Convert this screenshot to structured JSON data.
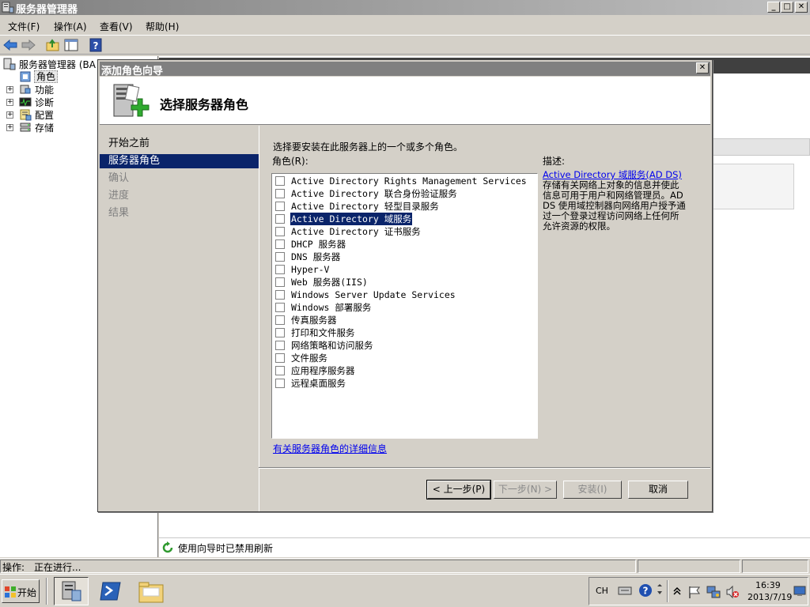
{
  "main_window": {
    "title": "服务器管理器",
    "controls": {
      "minimize": "_",
      "maximize": "□",
      "close": "✕"
    }
  },
  "menu": {
    "items": [
      "文件(F)",
      "操作(A)",
      "查看(V)",
      "帮助(H)"
    ]
  },
  "tree": {
    "root": "服务器管理器 (BA",
    "items": [
      "角色",
      "功能",
      "诊断",
      "配置",
      "存储"
    ],
    "expanders": [
      "+",
      "+",
      "+",
      "+"
    ]
  },
  "refresh_bar": {
    "text": "使用向导时已禁用刷新"
  },
  "status_bar": {
    "label": "操作:",
    "value": "正在进行..."
  },
  "taskbar": {
    "start_label": "开始",
    "tray": {
      "lang": "CH",
      "time": "16:39",
      "date": "2013/7/19"
    }
  },
  "dialog": {
    "title": "添加角色向导",
    "close": "✕",
    "header_title": "选择服务器角色",
    "nav": [
      {
        "label": "开始之前",
        "state": "normal"
      },
      {
        "label": "服务器角色",
        "state": "active"
      },
      {
        "label": "确认",
        "state": "disabled"
      },
      {
        "label": "进度",
        "state": "disabled"
      },
      {
        "label": "结果",
        "state": "disabled"
      }
    ],
    "instruction": "选择要安装在此服务器上的一个或多个角色。",
    "roles_label": "角色(R):",
    "roles": [
      {
        "label": "Active Directory Rights Management Services",
        "checked": false,
        "selected": false
      },
      {
        "label": "Active Directory 联合身份验证服务",
        "checked": false,
        "selected": false
      },
      {
        "label": "Active Directory 轻型目录服务",
        "checked": false,
        "selected": false
      },
      {
        "label": "Active Directory 域服务",
        "checked": false,
        "selected": true
      },
      {
        "label": "Active Directory 证书服务",
        "checked": false,
        "selected": false
      },
      {
        "label": "DHCP 服务器",
        "checked": false,
        "selected": false
      },
      {
        "label": "DNS 服务器",
        "checked": false,
        "selected": false
      },
      {
        "label": "Hyper-V",
        "checked": false,
        "selected": false
      },
      {
        "label": "Web 服务器(IIS)",
        "checked": false,
        "selected": false
      },
      {
        "label": "Windows Server Update Services",
        "checked": false,
        "selected": false
      },
      {
        "label": "Windows 部署服务",
        "checked": false,
        "selected": false
      },
      {
        "label": "传真服务器",
        "checked": false,
        "selected": false
      },
      {
        "label": "打印和文件服务",
        "checked": false,
        "selected": false
      },
      {
        "label": "网络策略和访问服务",
        "checked": false,
        "selected": false
      },
      {
        "label": "文件服务",
        "checked": false,
        "selected": false
      },
      {
        "label": "应用程序服务器",
        "checked": false,
        "selected": false
      },
      {
        "label": "远程桌面服务",
        "checked": false,
        "selected": false
      }
    ],
    "description_label": "描述:",
    "description_link": "Active Directory 域服务(AD DS)",
    "description_lines": [
      "存储有关网络上对象的信息并使此",
      "信息可用于用户和网络管理员。AD",
      "DS 使用域控制器向网络用户授予通",
      "过一个登录过程访问网络上任何所",
      "允许资源的权限。"
    ],
    "more_info_link": "有关服务器角色的详细信息",
    "buttons": {
      "back": "< 上一步(P)",
      "next": "下一步(N) >",
      "install": "安装(I)",
      "cancel": "取消"
    }
  }
}
